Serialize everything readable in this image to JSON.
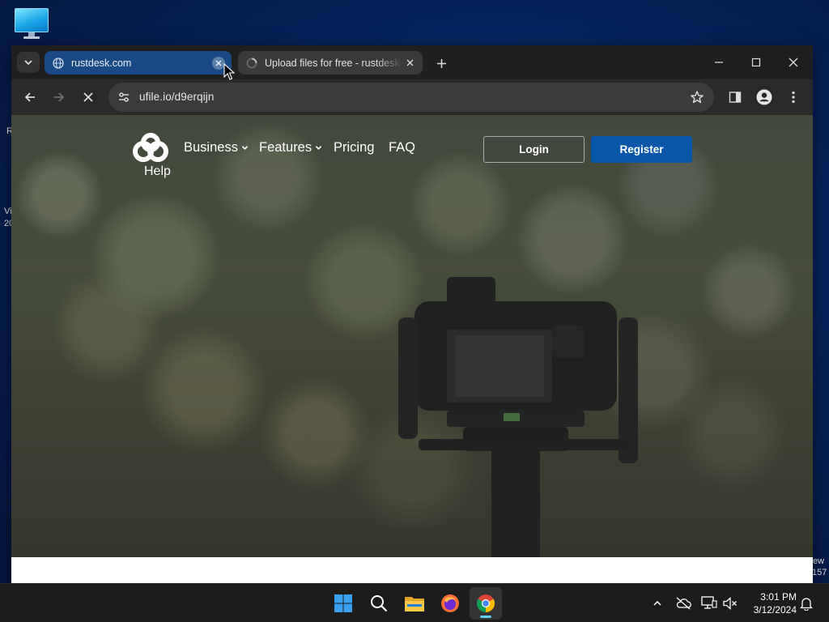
{
  "desktop": {
    "icon_name": "monitor-icon",
    "frag_left_1": "R",
    "frag_left_2": "Vi",
    "frag_left_3": "20",
    "frag_right_1": "ew",
    "frag_right_2": "157"
  },
  "browser": {
    "tabs": [
      {
        "title": "rustdesk.com",
        "active": true,
        "icon": "globe-icon"
      },
      {
        "title": "Upload files for free - rustdesk-",
        "active": false,
        "icon": "loading-icon"
      }
    ],
    "address": "ufile.io/d9erqijn",
    "colors": {
      "active_tab": "#1a4a86",
      "toolbar": "#2a2a2a",
      "titlebar": "#1f1f1f"
    }
  },
  "site": {
    "nav": {
      "help": "Help",
      "business": "Business",
      "features": "Features",
      "pricing": "Pricing",
      "faq": "FAQ"
    },
    "login": "Login",
    "register": "Register",
    "colors": {
      "register": "#0a57a9"
    }
  },
  "taskbar": {
    "apps": [
      "start-icon",
      "search-icon",
      "file-explorer-icon",
      "firefox-icon",
      "chrome-icon"
    ],
    "time": "3:01 PM",
    "date": "3/12/2024"
  }
}
